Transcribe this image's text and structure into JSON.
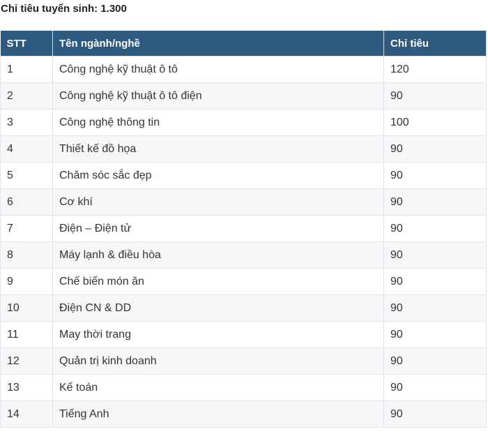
{
  "document": {
    "title": "Chỉ tiêu tuyển sinh: 1.300"
  },
  "table": {
    "headers": {
      "stt": "STT",
      "name": "Tên ngành/nghề",
      "quota": "Chỉ tiêu"
    },
    "rows": [
      {
        "stt": "1",
        "name": "Công nghệ kỹ thuật ô tô",
        "quota": "120"
      },
      {
        "stt": "2",
        "name": "Công nghệ kỹ thuật ô tô điện",
        "quota": "90"
      },
      {
        "stt": "3",
        "name": "Công nghệ thông tin",
        "quota": "100"
      },
      {
        "stt": "4",
        "name": "Thiết kế đồ họa",
        "quota": "90"
      },
      {
        "stt": "5",
        "name": "Chăm sóc sắc đẹp",
        "quota": "90"
      },
      {
        "stt": "6",
        "name": "Cơ khí",
        "quota": "90"
      },
      {
        "stt": "7",
        "name": "Điện – Điện tử",
        "quota": "90"
      },
      {
        "stt": "8",
        "name": "Máy lạnh & điều hòa",
        "quota": "90"
      },
      {
        "stt": "9",
        "name": "Chế biến món ăn",
        "quota": "90"
      },
      {
        "stt": "10",
        "name": "Điện CN & DD",
        "quota": "90"
      },
      {
        "stt": "11",
        "name": "May thời trang",
        "quota": "90"
      },
      {
        "stt": "12",
        "name": "Quản trị kinh doanh",
        "quota": "90"
      },
      {
        "stt": "13",
        "name": "Kế toán",
        "quota": "90"
      },
      {
        "stt": "14",
        "name": "Tiếng Anh",
        "quota": "90"
      }
    ]
  },
  "colors": {
    "header_background": "#2e5a7f",
    "header_text": "#ffffff",
    "zebra_row": "#f5f7f8"
  }
}
